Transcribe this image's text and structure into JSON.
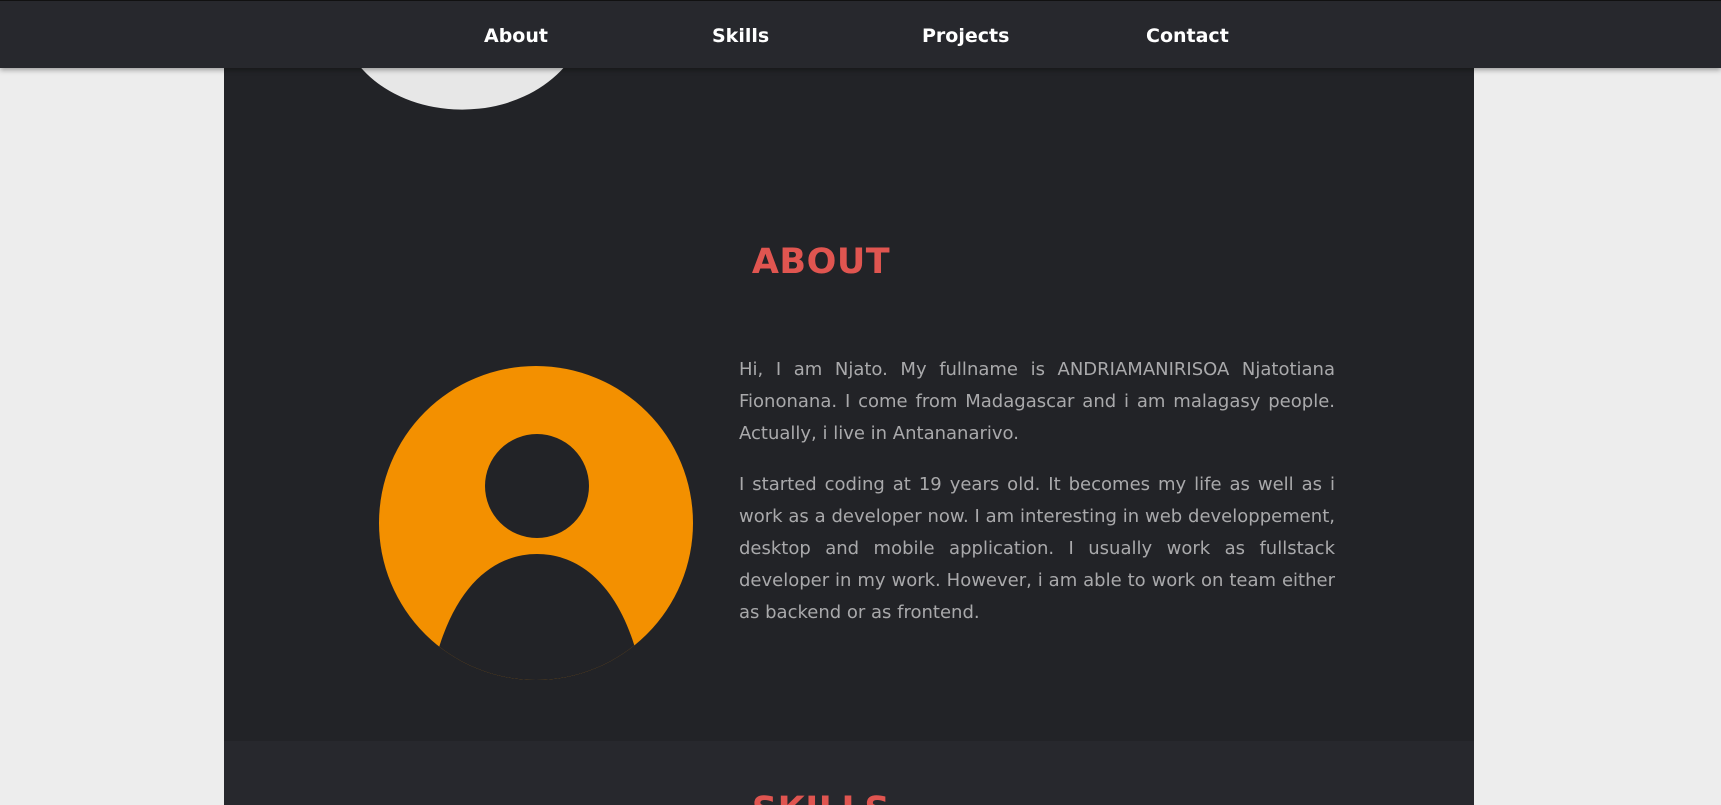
{
  "nav": {
    "items": [
      {
        "label": "About"
      },
      {
        "label": "Skills"
      },
      {
        "label": "Projects"
      },
      {
        "label": "Contact"
      }
    ]
  },
  "about": {
    "title": "ABOUT",
    "avatar_icon": "user-avatar-icon",
    "paragraphs": [
      "Hi, I am Njato. My fullname is ANDRIAMANIRISOA Njatotiana Fiononana. I come from Madagascar and i am malagasy people. Actually, i live in Antananarivo.",
      "I started coding at 19 years old. It becomes my life as well as i work as a developer now. I am interesting in web developpement, desktop and mobile application. I usually work as fullstack developer in my work. However, i am able to work on team either as backend or as frontend."
    ]
  },
  "skills": {
    "title": "SKILLS"
  },
  "colors": {
    "accent": "#e05550",
    "avatar": "#f39000",
    "background": "#222327",
    "navbar": "#27282d",
    "page": "#ededed",
    "text": "#a9a9ab"
  }
}
